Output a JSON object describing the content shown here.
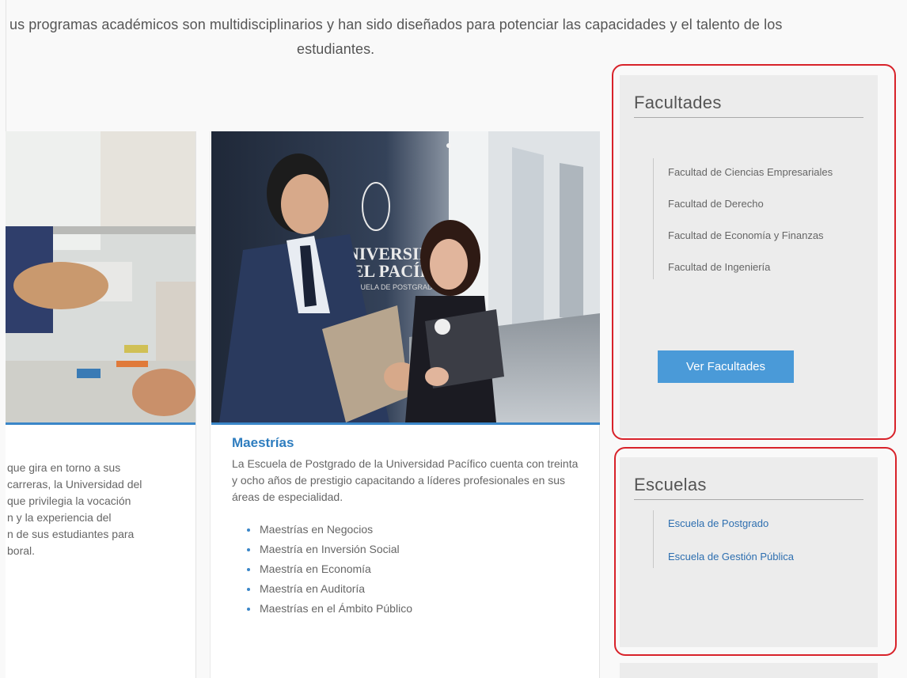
{
  "intro": {
    "line1": "us programas académicos son multidisciplinarios y han sido diseñados para potenciar las capacidades y el talento de los",
    "line2": "estudiantes."
  },
  "card_left": {
    "desc_lines": [
      "que gira en torno a sus",
      "carreras, la Universidad del",
      "que privilegia la vocación",
      "n y la experiencia del",
      "n de sus estudiantes para",
      "boral."
    ]
  },
  "card_mid": {
    "photo_sign_line1": "UNIVERSIDAD",
    "photo_sign_line2": "DEL PACÍFICO",
    "photo_sign_line3": "ESCUELA DE POSTGRADO",
    "title": "Maestrías",
    "description": "La Escuela de Postgrado de la Universidad Pacífico cuenta con treinta y ocho años de prestigio capacitando a líderes profesionales en sus áreas de especialidad.",
    "bullets": [
      "Maestrías en Negocios",
      "Maestría en Inversión Social",
      "Maestría en Economía",
      "Maestría en Auditoría",
      "Maestrías en el Ámbito Público"
    ]
  },
  "facultades": {
    "title": "Facultades",
    "items": [
      "Facultad de Ciencias Empresariales",
      "Facultad de Derecho",
      "Facultad de Economía y Finanzas",
      "Facultad de Ingeniería"
    ],
    "button_label": "Ver Facultades"
  },
  "escuelas": {
    "title": "Escuelas",
    "items": [
      "Escuela de Postgrado",
      "Escuela de Gestión Pública"
    ]
  },
  "colors": {
    "accent_blue": "#3a86c8",
    "button_blue": "#4a9ad8",
    "link_blue": "#2e6fb0",
    "highlight_red": "#d8222a",
    "panel_bg": "#ececec"
  }
}
